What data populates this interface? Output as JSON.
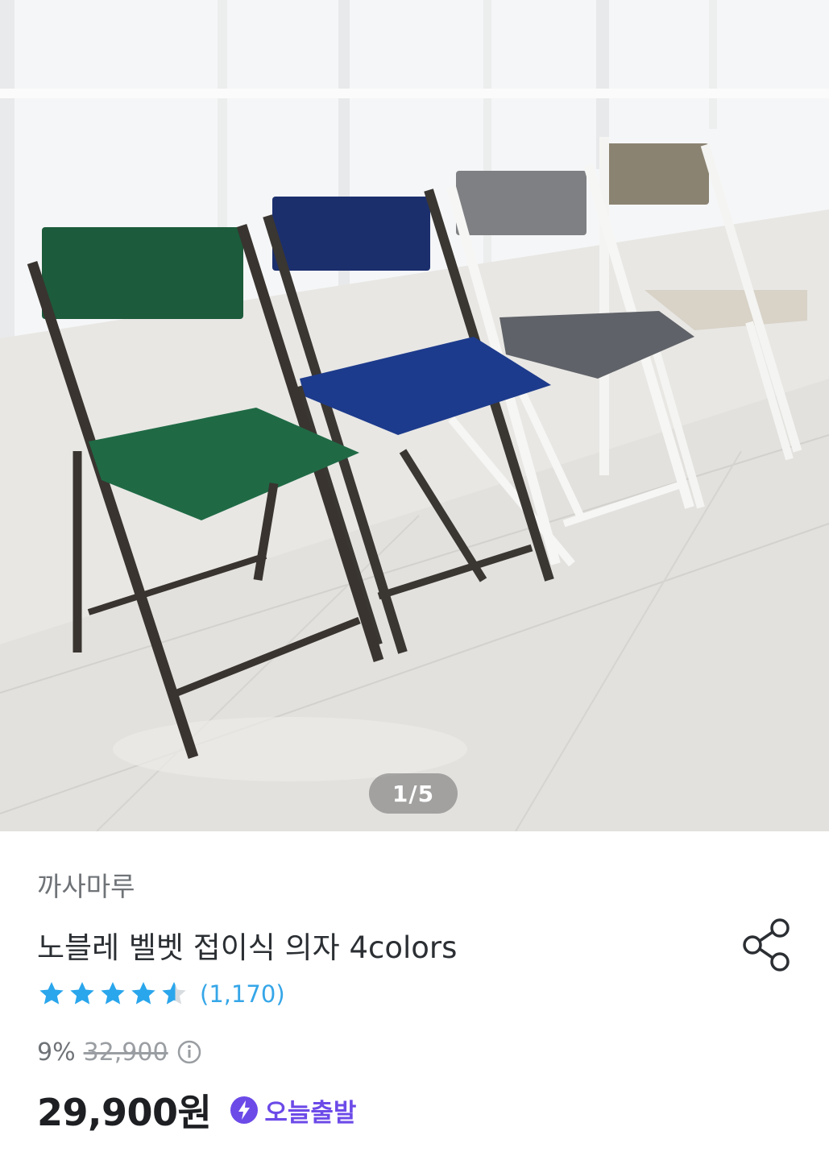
{
  "gallery": {
    "image_description_icon": "photo-folding-chairs",
    "counter": "1/5"
  },
  "product": {
    "brand": "까사마루",
    "title": "노블레 벨벳 접이식 의자 4colors",
    "rating": {
      "stars": 4.5,
      "review_count": "(1,170)"
    },
    "discount_rate": "9%",
    "original_price": "32,900",
    "price": "29,900원",
    "delivery_badge": "오늘출발"
  },
  "colors": {
    "star": "#2aa6ec",
    "review_link": "#35a6e8",
    "badge": "#6c4ae8"
  }
}
